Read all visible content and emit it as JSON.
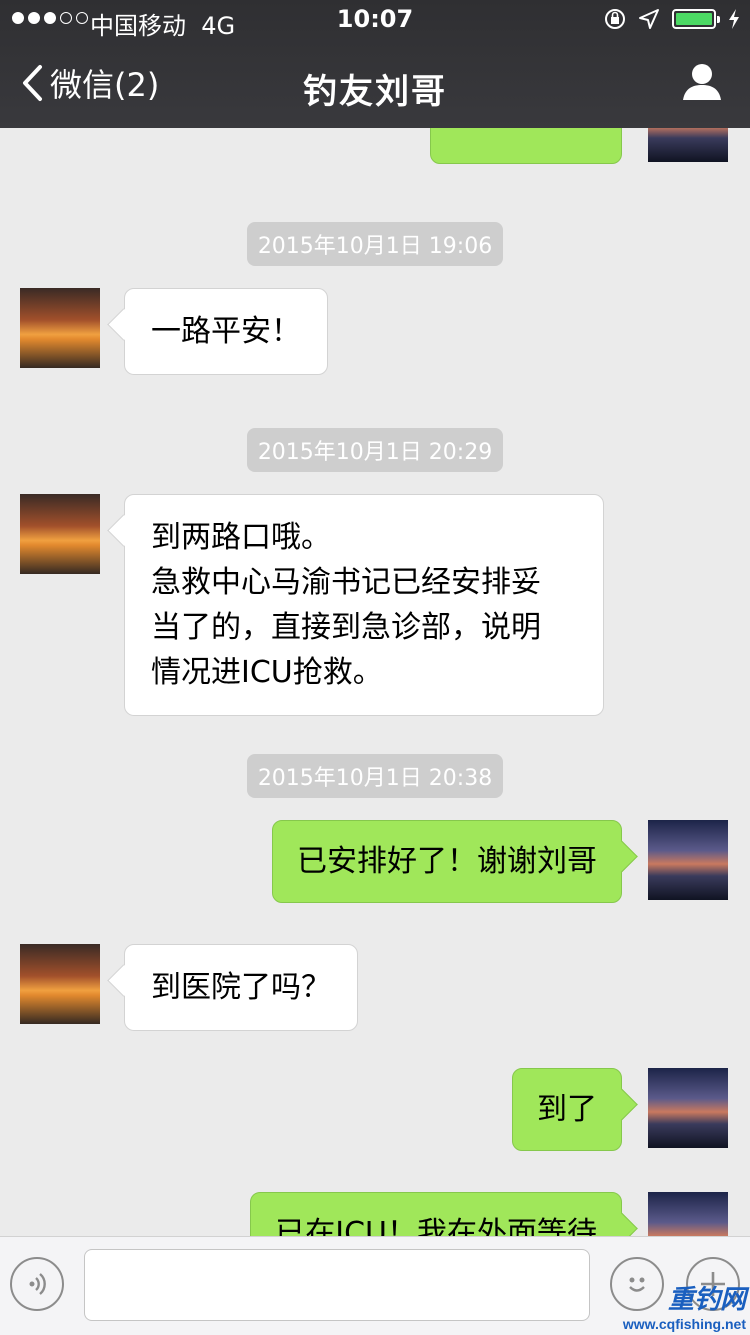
{
  "status_bar": {
    "signal_filled": 3,
    "signal_total": 5,
    "carrier": "中国移动",
    "network": "4G",
    "time": "10:07",
    "battery_level": 1.0
  },
  "nav": {
    "back_label": "微信(2)",
    "title": "钓友刘哥"
  },
  "timestamps": [
    "2015年10月1日 19:06",
    "2015年10月1日 20:29",
    "2015年10月1日 20:38"
  ],
  "messages": [
    {
      "side": "in",
      "lines": [
        "一路平安！"
      ]
    },
    {
      "side": "in",
      "lines": [
        "到两路口哦。",
        "急救中心马渝书记已经安排妥",
        "当了的，直接到急诊部，说明",
        "情况进ICU抢救。"
      ]
    },
    {
      "side": "out",
      "lines": [
        "已安排好了！谢谢刘哥"
      ]
    },
    {
      "side": "in",
      "lines": [
        "到医院了吗？"
      ]
    },
    {
      "side": "out",
      "lines": [
        "到了"
      ]
    },
    {
      "side": "out",
      "lines": [
        "已在ICU！我在外面等待"
      ]
    }
  ],
  "input_bar": {
    "voice_icon": "voice-icon",
    "emoji_icon": "emoji-icon",
    "plus_icon": "plus-icon"
  },
  "watermark": {
    "name": "重钓网",
    "url": "www.cqfishing.net"
  },
  "colors": {
    "header": "#333336",
    "background": "#ebebeb",
    "outgoing_bubble": "#a0e75a",
    "incoming_bubble": "#ffffff",
    "timestamp_bg": "#cecece"
  }
}
